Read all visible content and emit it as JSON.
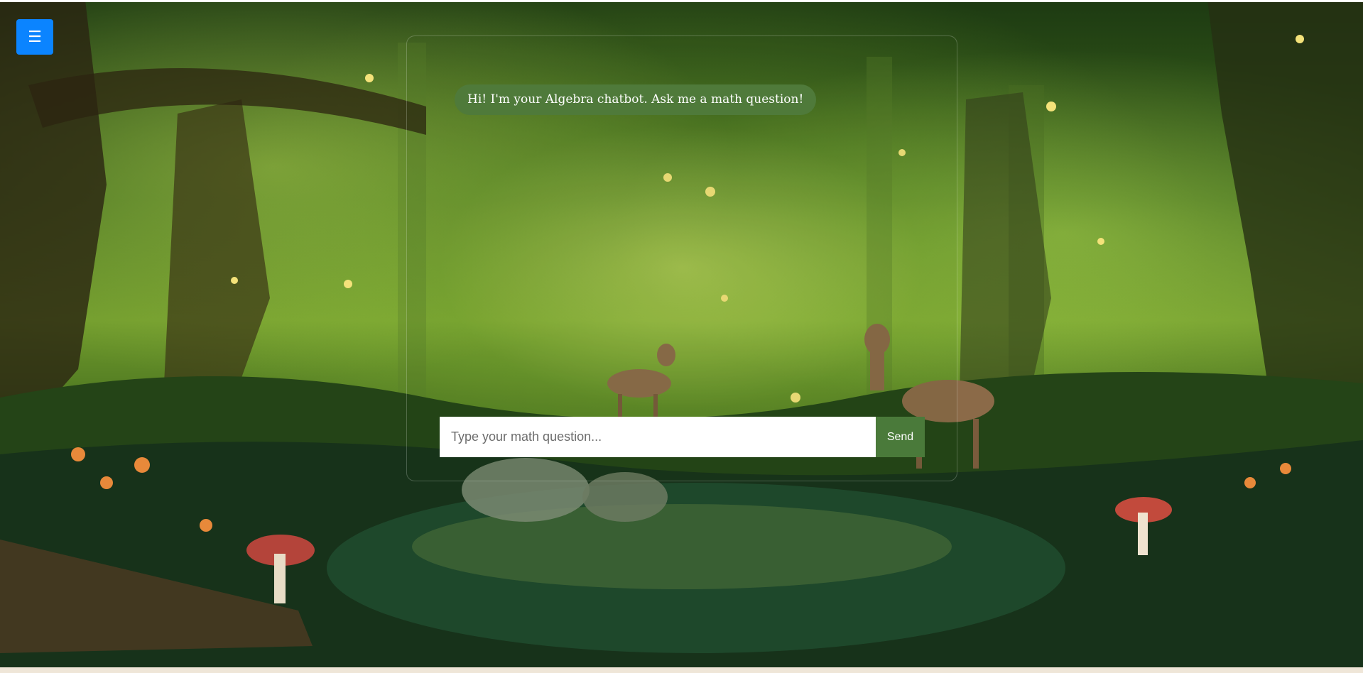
{
  "menu": {
    "icon": "hamburger-icon",
    "glyph": "☰"
  },
  "chat": {
    "messages": [
      {
        "sender": "bot",
        "text": "Hi! I'm your Algebra chatbot. Ask me a math question!"
      }
    ]
  },
  "input": {
    "placeholder": "Type your math question...",
    "value": ""
  },
  "send": {
    "label": "Send"
  },
  "colors": {
    "menu_button": "#0b84ff",
    "bubble": "#4f7a3a",
    "send_button": "#4a7a3a"
  }
}
